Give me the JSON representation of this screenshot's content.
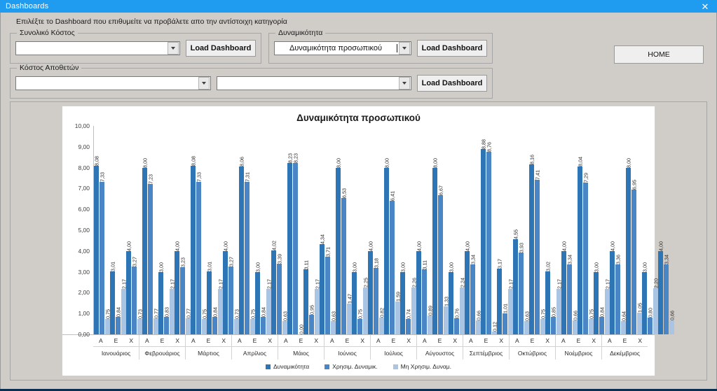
{
  "window": {
    "title": "Dashboards",
    "close_icon": "close-icon"
  },
  "instruction": "Επιλέξτε το Dashboard που επιθυμείτε να προβάλετε απο την αντίστοιχη κατηγορία",
  "groups": {
    "total_cost": {
      "title": "Συνολικό Κόστος",
      "combo_value": "",
      "combo_placeholder": "",
      "button_label": "Load Dashboard"
    },
    "capacity": {
      "title": "Δυναμικότητα",
      "combo_value": "Δυναμικότητα προσωπικού",
      "combo_placeholder": "",
      "button_label": "Load Dashboard"
    },
    "warehouse_cost": {
      "title": "Κόστος Αποθετών",
      "combo_value": "",
      "combo_placeholder": "",
      "combo2_value": "",
      "button_label": "Load Dashboard"
    }
  },
  "home_button": {
    "label": "HOME"
  },
  "colors": {
    "titlebar": "#1f9bf0",
    "series1": "#2E75B6",
    "series2": "#4A86C5",
    "series3": "#A9C5E3",
    "form_bg": "#d0ccc8"
  },
  "chart_data": {
    "type": "bar",
    "title": "Δυναμικότητα προσωπικού",
    "xlabel": "",
    "ylabel": "",
    "ylim": [
      0,
      10
    ],
    "ytick_labels": [
      "10,00",
      "9,00",
      "8,00",
      "7,00",
      "6,00",
      "5,00",
      "4,00",
      "3,00",
      "2,00",
      "1,00",
      "0,00"
    ],
    "ytick_values": [
      10,
      9,
      8,
      7,
      6,
      5,
      4,
      3,
      2,
      1,
      0
    ],
    "grid": false,
    "legend_position": "bottom",
    "legend": [
      "Δυναμικότητα",
      "Χρησιμ. Δυναμικ.",
      "Μη Χρησιμ. Δυναμ."
    ],
    "series_names": [
      "Δυναμικότητα",
      "Χρησιμ. Δυναμικ.",
      "Μη Χρησιμ. Δυναμ."
    ],
    "sub_categories": [
      "A",
      "E",
      "X"
    ],
    "categories": [
      "Ιανουάριος",
      "Φεβρουάριος",
      "Μάρτιος",
      "Απρίλιος",
      "Μάιος",
      "Ιούνιος",
      "Ιούλιος",
      "Αύγουστος",
      "Σεπτέμβριος",
      "Οκτώβριος",
      "Νοέμβριος",
      "Δεκέμβριος"
    ],
    "groups": [
      {
        "month": "Ιανουάριος",
        "subs": [
          {
            "sub": "A",
            "values": [
              8.08,
              7.33,
              0.75
            ],
            "labels": [
              "8,08",
              "7,33",
              "0,75"
            ]
          },
          {
            "sub": "E",
            "values": [
              3.01,
              0.84,
              2.17
            ],
            "labels": [
              "3,01",
              "0,84",
              "2,17"
            ]
          },
          {
            "sub": "X",
            "values": [
              4.0,
              3.27,
              0.73
            ],
            "labels": [
              "4,00",
              "3,27",
              "0,73"
            ]
          }
        ]
      },
      {
        "month": "Φεβρουάριος",
        "subs": [
          {
            "sub": "A",
            "values": [
              8.0,
              7.23,
              0.77
            ],
            "labels": [
              "8,00",
              "7,23",
              "0,77"
            ]
          },
          {
            "sub": "E",
            "values": [
              3.0,
              0.83,
              2.17
            ],
            "labels": [
              "3,00",
              "0,83",
              "2,17"
            ]
          },
          {
            "sub": "X",
            "values": [
              4.0,
              3.23,
              0.77
            ],
            "labels": [
              "4,00",
              "3,23",
              "0,77"
            ]
          }
        ]
      },
      {
        "month": "Μάρτιος",
        "subs": [
          {
            "sub": "A",
            "values": [
              8.08,
              7.33,
              0.75
            ],
            "labels": [
              "8,08",
              "7,33",
              "0,75"
            ]
          },
          {
            "sub": "E",
            "values": [
              3.01,
              0.84,
              2.17
            ],
            "labels": [
              "3,01",
              "0,84",
              "2,17"
            ]
          },
          {
            "sub": "X",
            "values": [
              4.0,
              3.27,
              0.73
            ],
            "labels": [
              "4,00",
              "3,27",
              "0,73"
            ]
          }
        ]
      },
      {
        "month": "Απρίλιος",
        "subs": [
          {
            "sub": "A",
            "values": [
              8.06,
              7.31,
              0.75
            ],
            "labels": [
              "8,06",
              "7,31",
              "0,75"
            ]
          },
          {
            "sub": "E",
            "values": [
              3.0,
              0.84,
              2.17
            ],
            "labels": [
              "3,00",
              "0,84",
              "2,17"
            ]
          },
          {
            "sub": "X",
            "values": [
              4.02,
              3.39,
              0.63
            ],
            "labels": [
              "4,02",
              "3,39",
              "0,63"
            ]
          }
        ]
      },
      {
        "month": "Μάιος",
        "subs": [
          {
            "sub": "A",
            "values": [
              8.23,
              8.23,
              0.0
            ],
            "labels": [
              "8,23",
              "8,23",
              "0,00"
            ]
          },
          {
            "sub": "E",
            "values": [
              3.11,
              0.95,
              2.17
            ],
            "labels": [
              "3,11",
              "0,95",
              "2,17"
            ]
          },
          {
            "sub": "X",
            "values": [
              4.34,
              3.71,
              0.63
            ],
            "labels": [
              "4,34",
              "3,71",
              "0,63"
            ]
          }
        ]
      },
      {
        "month": "Ιούνιος",
        "subs": [
          {
            "sub": "A",
            "values": [
              8.0,
              6.53,
              1.47
            ],
            "labels": [
              "8,00",
              "6,53",
              "1,47"
            ]
          },
          {
            "sub": "E",
            "values": [
              3.0,
              0.75,
              2.25
            ],
            "labels": [
              "3,00",
              "0,75",
              "2,25"
            ]
          },
          {
            "sub": "X",
            "values": [
              4.0,
              3.18,
              0.82
            ],
            "labels": [
              "4,00",
              "3,18",
              "0,82"
            ]
          }
        ]
      },
      {
        "month": "Ιούλιος",
        "subs": [
          {
            "sub": "A",
            "values": [
              8.0,
              6.41,
              1.59
            ],
            "labels": [
              "8,00",
              "6,41",
              "1,59"
            ]
          },
          {
            "sub": "E",
            "values": [
              3.0,
              0.74,
              2.26
            ],
            "labels": [
              "3,00",
              "0,74",
              "2,26"
            ]
          },
          {
            "sub": "X",
            "values": [
              4.0,
              3.11,
              0.89
            ],
            "labels": [
              "4,00",
              "3,11",
              "0,89"
            ]
          }
        ]
      },
      {
        "month": "Αύγουστος",
        "subs": [
          {
            "sub": "A",
            "values": [
              8.0,
              6.67,
              1.33
            ],
            "labels": [
              "8,00",
              "6,67",
              "1,33"
            ]
          },
          {
            "sub": "E",
            "values": [
              3.0,
              0.76,
              2.24
            ],
            "labels": [
              "3,00",
              "0,76",
              "2,24"
            ]
          },
          {
            "sub": "X",
            "values": [
              4.0,
              3.34,
              0.66
            ],
            "labels": [
              "4,00",
              "3,34",
              "0,66"
            ]
          }
        ]
      },
      {
        "month": "Σεπτέμβριος",
        "subs": [
          {
            "sub": "A",
            "values": [
              8.88,
              8.76,
              0.12
            ],
            "labels": [
              "8,88",
              "8,76",
              "0,12"
            ]
          },
          {
            "sub": "E",
            "values": [
              3.17,
              1.01,
              2.17
            ],
            "labels": [
              "3,17",
              "1,01",
              "2,17"
            ]
          },
          {
            "sub": "X",
            "values": [
              4.55,
              3.93,
              0.63
            ],
            "labels": [
              "4,55",
              "3,93",
              "0,63"
            ]
          }
        ]
      },
      {
        "month": "Οκτώβριος",
        "subs": [
          {
            "sub": "A",
            "values": [
              8.16,
              7.41,
              0.75
            ],
            "labels": [
              "8,16",
              "7,41",
              "0,75"
            ]
          },
          {
            "sub": "E",
            "values": [
              3.02,
              0.85,
              2.17
            ],
            "labels": [
              "3,02",
              "0,85",
              "2,17"
            ]
          },
          {
            "sub": "X",
            "values": [
              4.0,
              3.34,
              0.66
            ],
            "labels": [
              "4,00",
              "3,34",
              "0,66"
            ]
          }
        ]
      },
      {
        "month": "Νοέμβριος",
        "subs": [
          {
            "sub": "A",
            "values": [
              8.04,
              7.29,
              0.75
            ],
            "labels": [
              "8,04",
              "7,29",
              "0,75"
            ]
          },
          {
            "sub": "E",
            "values": [
              3.0,
              0.84,
              2.17
            ],
            "labels": [
              "3,00",
              "0,84",
              "2,17"
            ]
          },
          {
            "sub": "X",
            "values": [
              4.0,
              3.36,
              0.64
            ],
            "labels": [
              "4,00",
              "3,36",
              "0,64"
            ]
          }
        ]
      },
      {
        "month": "Δεκέμβριος",
        "subs": [
          {
            "sub": "A",
            "values": [
              8.0,
              6.95,
              1.05
            ],
            "labels": [
              "8,00",
              "6,95",
              "1,05"
            ]
          },
          {
            "sub": "E",
            "values": [
              3.0,
              0.8,
              2.2
            ],
            "labels": [
              "3,00",
              "0,80",
              "2,20"
            ]
          },
          {
            "sub": "X",
            "values": [
              4.0,
              3.34,
              0.66
            ],
            "labels": [
              "4,00",
              "3,34",
              "0,66"
            ]
          }
        ]
      }
    ]
  }
}
